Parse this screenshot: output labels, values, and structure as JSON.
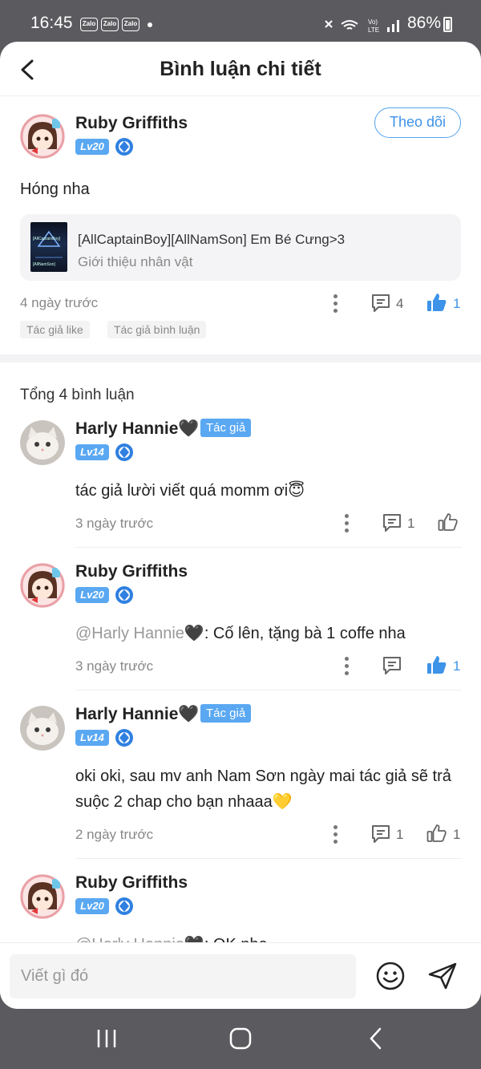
{
  "status_bar": {
    "time": "16:45",
    "notif": [
      "Zalo",
      "Zalo",
      "Zalo"
    ],
    "battery": "86%"
  },
  "header": {
    "title": "Bình luận chi tiết"
  },
  "post": {
    "author": "Ruby Griffiths",
    "level": "Lv20",
    "follow_label": "Theo dõi",
    "text": "Hóng nha",
    "story": {
      "title": "[AllCaptainBoy][AllNamSon] Em Bé Cưng>3",
      "subtitle": "Giới thiệu nhân vật",
      "cover_text_1": "[AllCaptainBoy]",
      "cover_text_2": "[AllNamSon]"
    },
    "time": "4 ngày trước",
    "comment_count": "4",
    "like_count": "1",
    "tags": [
      "Tác giả like",
      "Tác giả bình luận"
    ]
  },
  "total_label": "Tổng 4 bình luận",
  "comments": [
    {
      "author": "Harly Hannie🖤",
      "author_tag": "Tác giả",
      "level": "Lv14",
      "text": "tác giả lười viết quá momm ơi😇",
      "time": "3 ngày trước",
      "reply_count": "1",
      "like_count": ""
    },
    {
      "author": "Ruby Griffiths",
      "level": "Lv20",
      "mention": "@Harly Hannie🖤",
      "text": ": Cố lên, tặng bà 1 coffe nha",
      "time": "3 ngày trước",
      "reply_count": "",
      "like_count": "1"
    },
    {
      "author": "Harly Hannie🖤",
      "author_tag": "Tác giả",
      "level": "Lv14",
      "text": "oki oki, sau mv anh Nam Sơn ngày mai tác giả sẽ trả suộc 2 chap cho bạn nhaaa💛",
      "time": "2 ngày trước",
      "reply_count": "1",
      "like_count": "1"
    },
    {
      "author": "Ruby Griffiths",
      "level": "Lv20",
      "mention": "@Harly Hannie🖤",
      "text": ": OK nha"
    }
  ],
  "input": {
    "placeholder": "Viết gì đó"
  },
  "colors": {
    "accent": "#3d93e8",
    "badge": "#5aa8f2"
  }
}
